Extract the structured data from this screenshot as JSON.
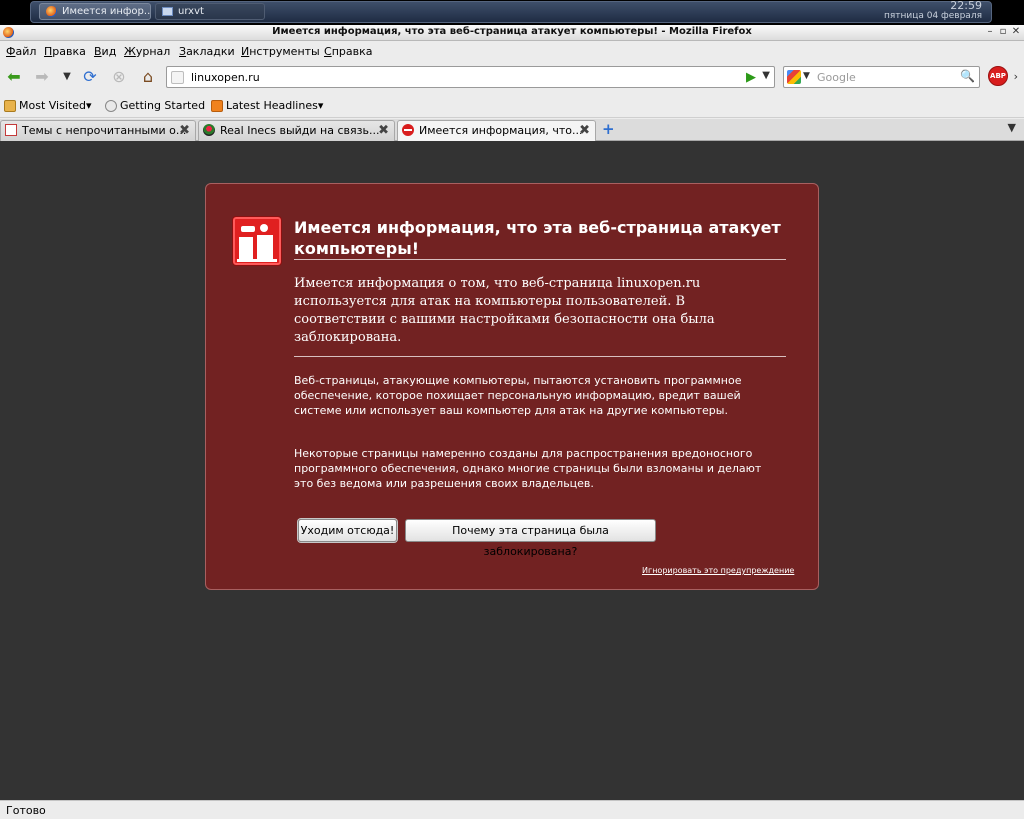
{
  "taskbar": {
    "tasks": [
      {
        "label": "Имеется инфор...",
        "icon": "firefox-icon"
      },
      {
        "label": "urxvt",
        "icon": "terminal-icon"
      }
    ],
    "time": "22:59",
    "date": "пятница 04 февраля"
  },
  "window": {
    "title": "Имеется информация, что эта веб-страница атакует компьютеры! - Mozilla Firefox",
    "controls": [
      "–",
      "▫",
      "✕"
    ]
  },
  "menu": {
    "items": [
      "Файл",
      "Правка",
      "Вид",
      "Журнал",
      "Закладки",
      "Инструменты",
      "Справка"
    ]
  },
  "navbar": {
    "url": "linuxopen.ru",
    "search_placeholder": "Google",
    "abp_label": "ABP"
  },
  "bookmarks": {
    "items": [
      "Most Visited",
      "Getting Started",
      "Latest Headlines"
    ]
  },
  "tabs": {
    "items": [
      {
        "label": "Темы с непрочитанными о...",
        "icon": "forum-icon"
      },
      {
        "label": "Real Inecs выйди на связь...",
        "icon": "site-icon"
      },
      {
        "label": "Имеется информация, что...",
        "icon": "blocked-icon",
        "selected": true
      }
    ]
  },
  "error": {
    "title": "Имеется информация, что эта веб-страница атакует компьютеры!",
    "short_desc": "Имеется информация о том, что веб-страница linuxopen.ru используется для атак на компьютеры пользователей. В соответствии с вашими настройками безопасности она была заблокирована.",
    "long_desc_1": "Веб-страницы, атакующие компьютеры, пытаются установить программное обеспечение, которое похищает персональную информацию, вредит вашей системе или использует ваш компьютер для атак на другие компьютеры.",
    "long_desc_2": "Некоторые страницы намеренно созданы для распространения вредоносного программного обеспечения, однако многие страницы были взломаны и делают это без ведома или разрешения своих владельцев.",
    "get_out_label": "Уходим отсюда!",
    "why_label": "Почему эта страница была заблокирована?",
    "ignore_label": "Игнорировать это предупреждение"
  },
  "status": {
    "text": "Готово"
  },
  "colors": {
    "error_bg": "#722222",
    "content_bg": "#333333",
    "abp_red": "#d81d1d"
  }
}
